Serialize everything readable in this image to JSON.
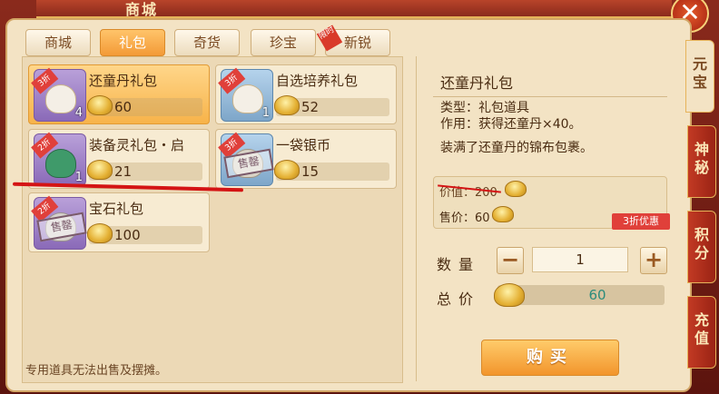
{
  "window": {
    "title": "商城",
    "close_label": "✕"
  },
  "tabs": [
    {
      "label": "商城",
      "active": false
    },
    {
      "label": "礼包",
      "active": true
    },
    {
      "label": "奇货",
      "active": false
    },
    {
      "label": "珍宝",
      "active": false
    },
    {
      "label": "新锐",
      "active": false,
      "badge": "限时"
    }
  ],
  "items": [
    {
      "name": "还童丹礼包",
      "price": "60",
      "qty": "4",
      "discount": "3折",
      "selected": true
    },
    {
      "name": "自选培养礼包",
      "price": "52",
      "qty": "1",
      "discount": "3折",
      "selected": false
    },
    {
      "name": "装备灵礼包・启",
      "price": "21",
      "qty": "1",
      "discount": "2折",
      "selected": false
    },
    {
      "name": "一袋银币",
      "price": "15",
      "qty": "",
      "discount": "3折",
      "selected": false,
      "stamp": "售罄"
    },
    {
      "name": "宝石礼包",
      "price": "100",
      "qty": "",
      "discount": "2折",
      "selected": false,
      "stamp": "售罄"
    }
  ],
  "footer_note": "专用道具无法出售及摆摊。",
  "detail": {
    "title": "还童丹礼包",
    "type_line": "类型：礼包道具",
    "effect_line": "作用：获得还童丹×40。",
    "desc_line": "装满了还童丹的锦布包裹。",
    "orig_price": "价值：200",
    "sale_price": "售价：60",
    "deal_badge": "3折优惠",
    "qty_label": "数量",
    "qty_value": "1",
    "minus_label": "−",
    "plus_label": "+",
    "total_label": "总价",
    "total_value": "60",
    "buy_label": "购买"
  },
  "side_tabs": [
    {
      "label": "元宝",
      "active": true
    },
    {
      "label": "神秘",
      "active": false
    },
    {
      "label": "积分",
      "active": false
    },
    {
      "label": "充值",
      "active": false
    }
  ],
  "colors": {
    "accent": "#f39a37",
    "discount": "#e0403a",
    "highlight": "#d41414"
  }
}
